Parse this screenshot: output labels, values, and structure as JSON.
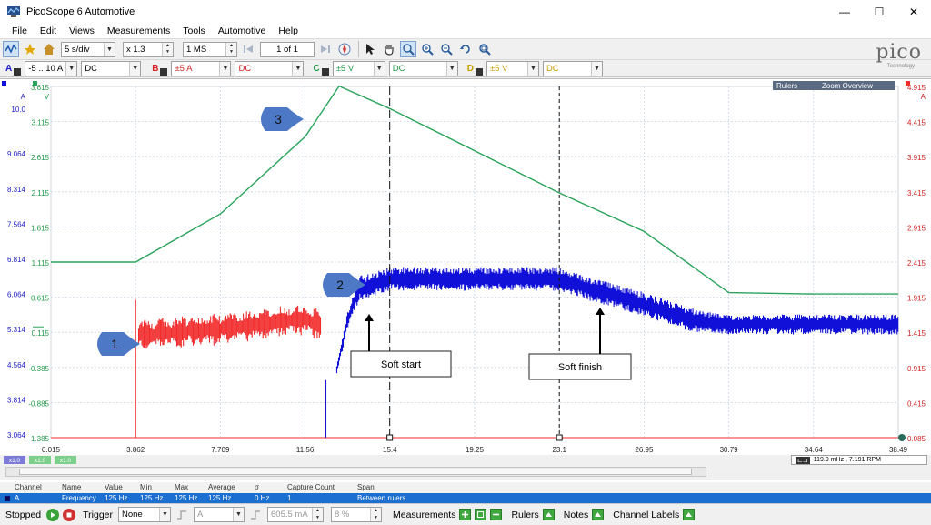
{
  "app": {
    "title": "PicoScope 6 Automotive"
  },
  "window_buttons": {
    "minimize": "—",
    "maximize": "☐",
    "close": "✕"
  },
  "menu": [
    "File",
    "Edit",
    "Views",
    "Measurements",
    "Tools",
    "Automotive",
    "Help"
  ],
  "toolbar": {
    "timebase": "5 s/div",
    "zoom": "x 1.3",
    "samples": "1 MS",
    "buffer": "1 of 1"
  },
  "channels": [
    {
      "letter": "A",
      "range": "-5 .. 10 A",
      "coupling": "DC",
      "color": "#1c1cc8"
    },
    {
      "letter": "B",
      "range": "±5 A",
      "coupling": "DC",
      "color": "#d42020"
    },
    {
      "letter": "C",
      "range": "±5 V",
      "coupling": "DC",
      "color": "#1f9a46"
    },
    {
      "letter": "D",
      "range": "±5 V",
      "coupling": "DC",
      "color": "#c8a000"
    }
  ],
  "logo": {
    "word": "pico",
    "sub": "Technology"
  },
  "scope": {
    "axis_a_units": "A",
    "axis_c_units": "V",
    "axis_b_units": "A",
    "axis_a_ticks": [
      "10.0",
      "9.064",
      "8.314",
      "7.564",
      "6.814",
      "6.064",
      "5.314",
      "4.564",
      "3.814",
      "3.064"
    ],
    "axis_c_ticks": [
      "3.615",
      "3.115",
      "2.615",
      "2.115",
      "1.615",
      "1.115",
      "0.615",
      "0.115",
      "-0.385",
      "-0.885",
      "-1.385"
    ],
    "axis_b_ticks": [
      "4.915",
      "4.415",
      "3.915",
      "3.415",
      "2.915",
      "2.415",
      "1.915",
      "1.415",
      "0.915",
      "0.415",
      "0.085"
    ],
    "x_ticks": [
      "0.015",
      "3.862",
      "7.709",
      "11.56",
      "15.4",
      "19.25",
      "23.1",
      "26.95",
      "30.79",
      "34.64",
      "38.49"
    ],
    "x_units": "s",
    "panel_tabs": [
      "Rulers",
      "Zoom Overview"
    ],
    "callouts": [
      "1",
      "2",
      "3"
    ],
    "annotations": [
      "Soft start",
      "Soft finish"
    ],
    "ruler_readout": "119.9 mHz , 7.191 RPM",
    "scale_badges": [
      "x1.0",
      "x1.0",
      "x1.0"
    ]
  },
  "chart_data": {
    "type": "line",
    "x_unit": "s",
    "xlim": [
      0.015,
      38.49
    ],
    "series": [
      {
        "name": "C",
        "unit": "V",
        "x": [
          0.015,
          3.862,
          7.709,
          11.56,
          13.1,
          15.4,
          19.25,
          23.1,
          26.95,
          30.79,
          34.64,
          38.49
        ],
        "values": [
          1.115,
          1.115,
          1.8,
          2.9,
          3.62,
          3.3,
          2.7,
          2.1,
          1.55,
          0.68,
          0.66,
          0.66
        ]
      },
      {
        "name": "A",
        "unit": "A",
        "x": [
          12.5,
          13.0,
          13.5,
          14.0,
          15.4,
          19.25,
          23.1,
          24.5,
          26.95,
          29.0,
          30.79,
          34.64,
          38.49
        ],
        "values": [
          3.06,
          4.4,
          5.4,
          6.0,
          6.2,
          6.2,
          6.2,
          6.0,
          5.7,
          5.4,
          5.3,
          5.3,
          5.3
        ]
      },
      {
        "name": "B",
        "unit": "A",
        "x": [
          0.015,
          3.862,
          4.2,
          7.709,
          11.56,
          12.5,
          38.49
        ],
        "values": [
          0.085,
          0.085,
          1.55,
          1.62,
          1.75,
          0.085,
          0.085
        ]
      }
    ]
  },
  "measurements": {
    "headers": [
      "Channel",
      "Name",
      "Value",
      "Min",
      "Max",
      "Average",
      "σ",
      "Capture Count",
      "Span"
    ],
    "row": [
      "A",
      "Frequency",
      "125 Hz",
      "125 Hz",
      "125 Hz",
      "125 Hz",
      "0 Hz",
      "1",
      "Between rulers"
    ]
  },
  "statusbar": {
    "state": "Stopped",
    "trigger_label": "Trigger",
    "trigger_mode": "None",
    "trigger_channel": "A",
    "trigger_level": "605.5 mA",
    "trigger_percent": "8 %",
    "measurements_label": "Measurements",
    "rulers_label": "Rulers",
    "notes_label": "Notes",
    "channel_labels_label": "Channel Labels"
  }
}
